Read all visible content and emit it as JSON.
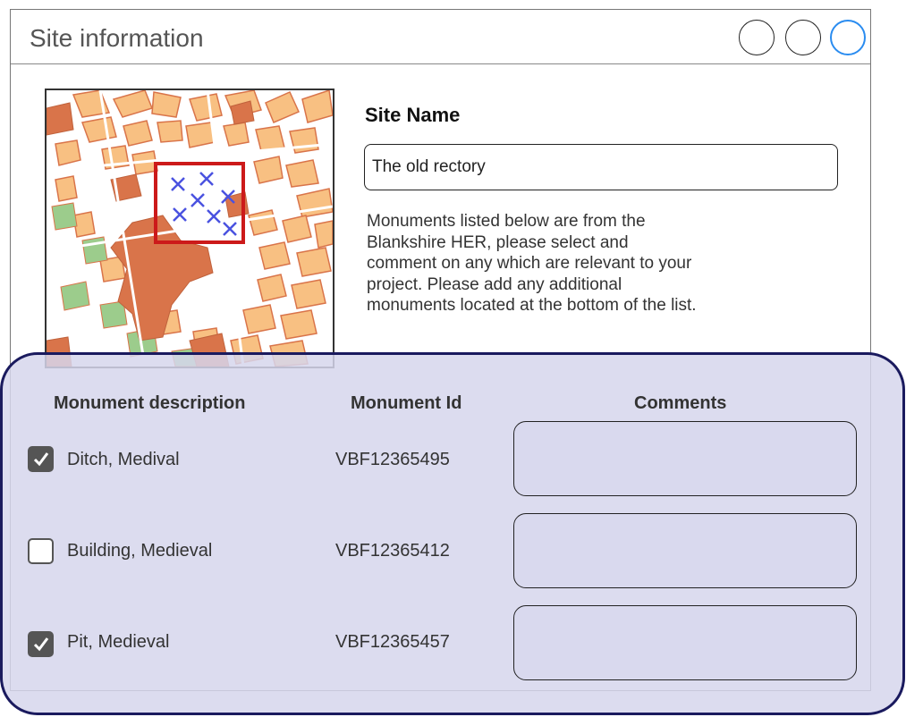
{
  "window": {
    "title": "Site information"
  },
  "site": {
    "name_label": "Site Name",
    "name_value": "The old rectory",
    "description_lines": [
      "Monuments listed below are from the",
      "Blankshire HER, please select and",
      "comment on any which are relevant to your",
      "project. Please add any additional",
      "monuments located at the bottom of the list."
    ]
  },
  "table": {
    "headers": {
      "description": "Monument description",
      "id": "Monument Id",
      "comments": "Comments"
    },
    "rows": [
      {
        "description": "Ditch, Medival",
        "id": "VBF12365495",
        "checked": true,
        "comment": ""
      },
      {
        "description": "Building, Medieval",
        "id": "VBF12365412",
        "checked": false,
        "comment": ""
      },
      {
        "description": "Pit, Medieval",
        "id": "VBF12365457",
        "checked": true,
        "comment": ""
      }
    ]
  },
  "colors": {
    "panel_fill": "#d6d6ec",
    "panel_border": "#1a1a5e",
    "map_selection": "#cc1a1a",
    "map_marker": "#4a52e0",
    "map_building": "#f8c082",
    "map_major": "#d9744a",
    "map_park": "#9ccc8c",
    "accent_button": "#2a8cf0"
  },
  "icons": {
    "map": "map-thumbnail",
    "marker": "x-marker-icon",
    "check": "checkmark-icon",
    "window_buttons": [
      "circle-button-icon",
      "circle-button-icon",
      "circle-button-icon"
    ]
  }
}
